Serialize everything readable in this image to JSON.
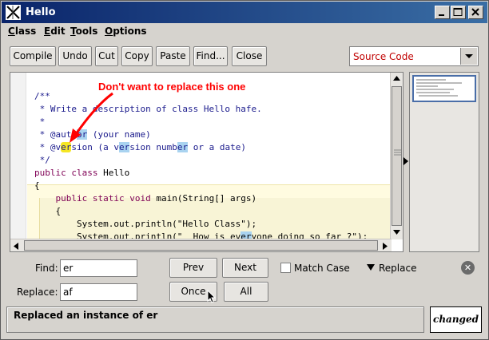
{
  "window": {
    "title": "Hello"
  },
  "menu": {
    "items": [
      "Class",
      "Edit",
      "Tools",
      "Options"
    ]
  },
  "toolbar": {
    "buttons": [
      "Compile",
      "Undo",
      "Cut",
      "Copy",
      "Paste",
      "Find...",
      "Close"
    ],
    "view_select": "Source Code"
  },
  "editor": {
    "lines": [
      "/**",
      " * Write a description of class Hello hafe.",
      " *",
      " * @author (your name)",
      " * @version (a version number or a date)",
      " */",
      "public class Hello",
      "{",
      "    public static void main(String[] args)",
      "    {",
      "        System.out.println(\"Hello Class\");",
      "        System.out.println(\"  How is everyone doing so far ?\");"
    ],
    "annotation": "Don't want to replace this one"
  },
  "find_panel": {
    "find_label": "Find:",
    "find_value": "er",
    "replace_label": "Replace:",
    "replace_value": "af",
    "prev_label": "Prev",
    "next_label": "Next",
    "match_case_label": "Match Case",
    "replace_toggle_label": "Replace",
    "once_label": "Once",
    "all_label": "All"
  },
  "status": {
    "message": "Replaced an instance of er",
    "changed": "changed"
  },
  "colors": {
    "title_bar": "#0a246a",
    "annotation": "#ff0000",
    "select_text": "#c00000",
    "match_highlight": "#a9d3f0",
    "current_match": "#f5e623"
  }
}
